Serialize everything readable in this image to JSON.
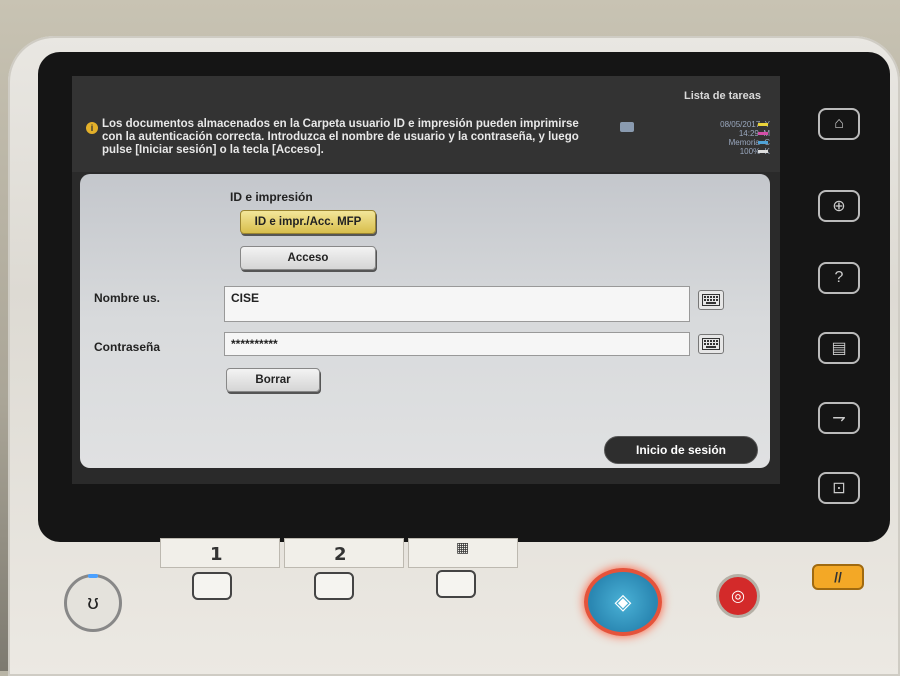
{
  "screen": {
    "message": "Los documentos almacenados en la Carpeta usuario ID e impresión pueden imprimirse con la autenticación correcta. Introduzca el nombre de usuario y la contraseña, y luego pulse [Iniciar sesión] o la tecla [Acceso].",
    "task_list_label": "Lista de tareas",
    "status": {
      "date": "08/05/2017",
      "time": "14:29",
      "memory_label": "Memoria",
      "memory_value": "100%",
      "toner_labels": [
        "Y",
        "M",
        "C",
        "K"
      ],
      "toner_colors": [
        "#e8d23a",
        "#d34fa8",
        "#4fa3d8",
        "#dddddd"
      ]
    }
  },
  "form": {
    "section_title": "ID e impresión",
    "id_print_button": "ID e impr./Acc. MFP",
    "access_button": "Acceso",
    "username_label": "Nombre us.",
    "username_value": "CISE",
    "password_label": "Contraseña",
    "password_value": "**********",
    "clear_button": "Borrar",
    "login_button": "Inicio de sesión"
  },
  "side_buttons": [
    {
      "name": "home-icon",
      "glyph": "⌂"
    },
    {
      "name": "zoom-icon",
      "glyph": "⊕"
    },
    {
      "name": "help-icon",
      "glyph": "?"
    },
    {
      "name": "panel-icon",
      "glyph": "▤"
    },
    {
      "name": "function-icon",
      "glyph": "⇁"
    },
    {
      "name": "preview-icon",
      "glyph": "⊡"
    }
  ],
  "hardware": {
    "key_1_label": "1",
    "key_2_label": "2",
    "keypad_glyph": "▦",
    "power_glyph": "ʊ",
    "start_glyph": "◈",
    "stop_glyph": "◎",
    "reset_glyph": "//"
  }
}
